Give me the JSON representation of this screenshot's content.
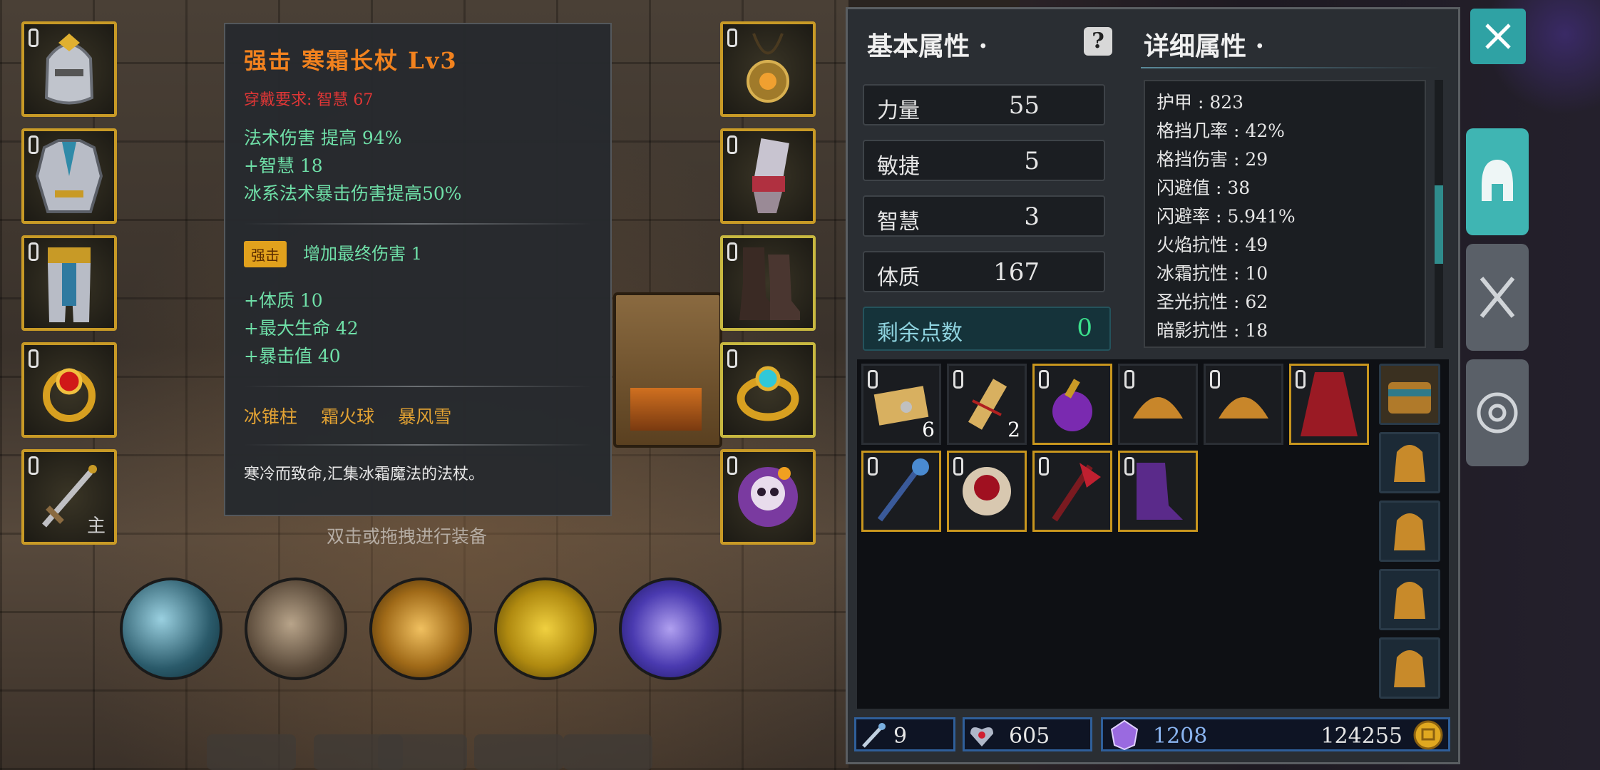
{
  "tooltip": {
    "title": "强击  寒霜长杖  Lv3",
    "requirement": "穿戴要求:   智慧 67",
    "base_stats": [
      "法术伤害 提高 94%",
      "+智慧 18",
      "冰系法术暴击伤害提高50%"
    ],
    "enhance_badge": "强击",
    "enhance_text": "增加最终伤害 1",
    "extra_stats": [
      "+体质 10",
      "+最大生命 42",
      "+暴击值 40"
    ],
    "skills": [
      "冰锥柱",
      "霜火球",
      "暴风雪"
    ],
    "description": "寒冷而致命,汇集冰霜魔法的法杖。"
  },
  "hint": "双击或拖拽进行装备",
  "main_hand_tag": "主",
  "panel": {
    "basic_title": "基本属性 ·",
    "detail_title": "详细属性 ·",
    "help_icon": "?",
    "stats": [
      {
        "name": "力量",
        "value": "55"
      },
      {
        "name": "敏捷",
        "value": "5"
      },
      {
        "name": "智慧",
        "value": "3"
      },
      {
        "name": "体质",
        "value": "167"
      }
    ],
    "remaining": {
      "name": "剩余点数",
      "value": "0"
    },
    "details": [
      "护甲 : 823",
      "格挡几率 : 42%",
      "格挡伤害 : 29",
      "闪避值 : 38",
      "闪避率 : 5.941%",
      "火焰抗性 : 49",
      "冰霜抗性 : 10",
      "圣光抗性 : 62",
      "暗影抗性 : 18"
    ]
  },
  "inventory": {
    "counts": {
      "scroll1": "6",
      "scroll2": "2"
    }
  },
  "currency": {
    "crafting": "9",
    "crystal_heart": "605",
    "gem": "1208",
    "gold": "124255"
  },
  "colors": {
    "gold_border": "#c89a26",
    "teal_accent": "#3fb5b3",
    "orange_title": "#f2821e",
    "green_stat": "#6fe0a8"
  }
}
